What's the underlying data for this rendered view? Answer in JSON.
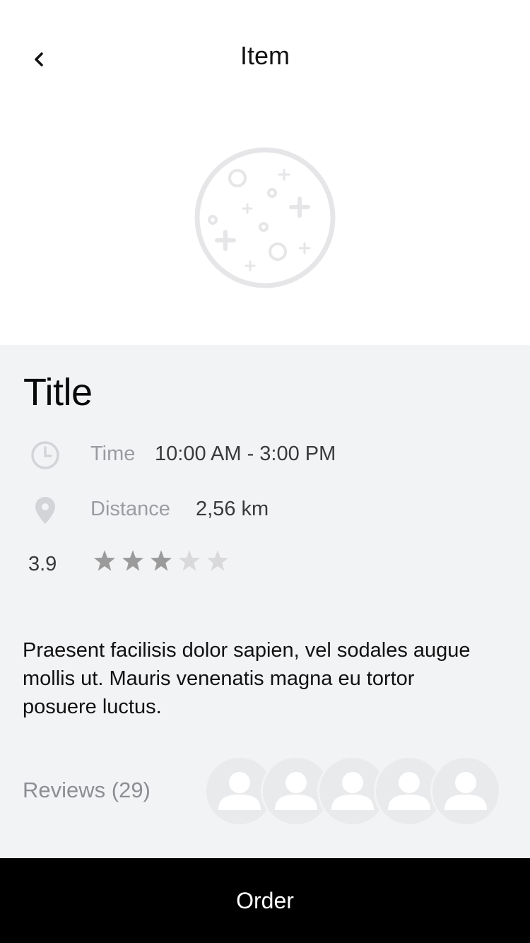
{
  "nav": {
    "title": "Item",
    "back_icon": "chevron-left-icon"
  },
  "hero": {
    "icon": "placeholder-food-icon"
  },
  "item": {
    "title": "Title",
    "time_label": "Time",
    "time_value": "10:00 AM - 3:00 PM",
    "distance_label": "Distance",
    "distance_value": "2,56 km",
    "rating_text": "3.9",
    "rating_value": 3.9,
    "rating_max": 5,
    "description": "Praesent facilisis dolor sapien, vel sodales augue mollis ut. Mauris venenatis magna eu tortor posuere luctus."
  },
  "reviews": {
    "label": "Reviews (29)",
    "avatar_count": 5
  },
  "footer": {
    "order_label": "Order"
  },
  "colors": {
    "background": "#ffffff",
    "content_background": "#f2f3f5",
    "star_filled": "#9b9b9b",
    "star_empty": "#d9d9db",
    "order_button": "#000000"
  }
}
